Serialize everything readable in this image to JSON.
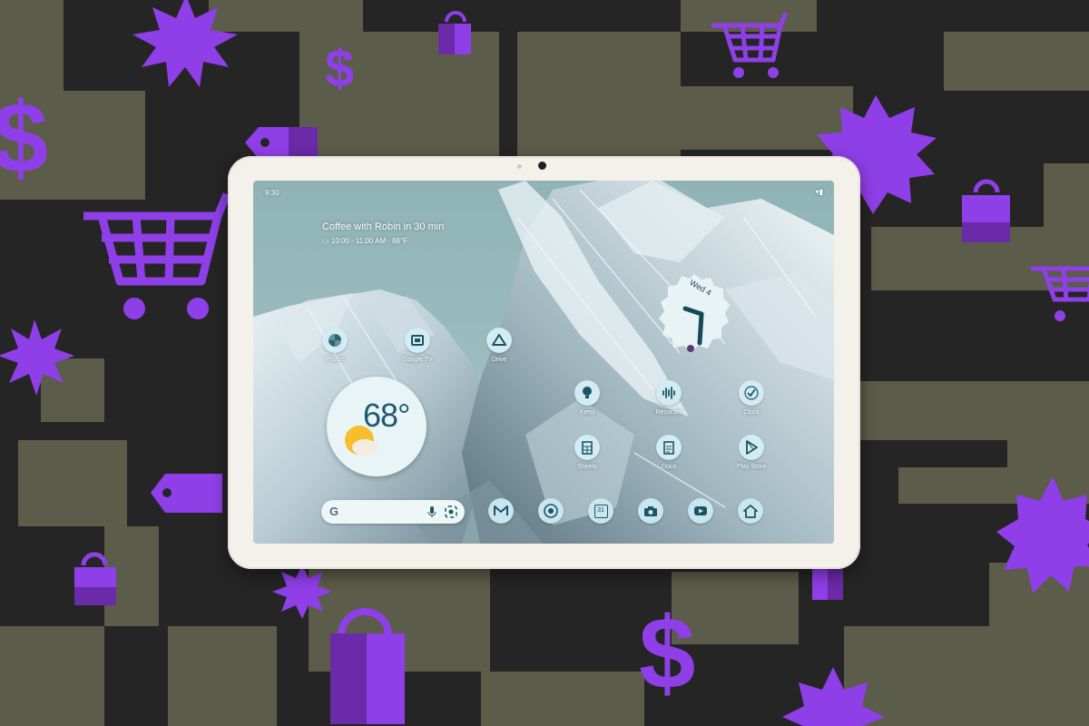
{
  "status_bar": {
    "time": "9:30",
    "icons": "▾▮"
  },
  "at_a_glance": {
    "event": "Coffee with Robin in 30 min",
    "details": "10:00 - 11:00 AM  ·  68°F"
  },
  "weather_widget": {
    "temperature": "68°"
  },
  "clock_widget": {
    "date": "Wed 4"
  },
  "home_apps": [
    {
      "label": "Photos",
      "icon": "pinwheel-icon"
    },
    {
      "label": "Google TV",
      "icon": "tv-icon"
    },
    {
      "label": "Drive",
      "icon": "drive-icon"
    },
    {
      "label": "Keep",
      "icon": "lightbulb-icon"
    },
    {
      "label": "Recorder",
      "icon": "waveform-icon"
    },
    {
      "label": "Clock",
      "icon": "clock-icon"
    },
    {
      "label": "Sheets",
      "icon": "spreadsheet-icon"
    },
    {
      "label": "Docs",
      "icon": "document-icon"
    },
    {
      "label": "Play Store",
      "icon": "play-store-icon"
    }
  ],
  "search_bar": {
    "logo": "G"
  },
  "dock": [
    {
      "icon": "gmail-icon"
    },
    {
      "icon": "chrome-icon"
    },
    {
      "icon": "calendar-icon",
      "text": "31"
    },
    {
      "icon": "camera-icon"
    },
    {
      "icon": "youtube-icon"
    },
    {
      "icon": "home-icon"
    }
  ],
  "colors": {
    "background": "#252525",
    "olive_blocks": "#5b5c49",
    "purple": "#8f3fe8",
    "purple_dark": "#6b2aa8",
    "tablet_bezel": "#f4f0ea",
    "icon_bg": "#d3ecf3",
    "icon_fg": "#1c5466"
  }
}
